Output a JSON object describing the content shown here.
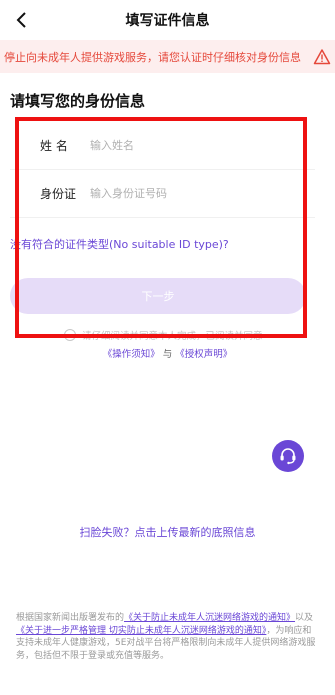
{
  "header": {
    "title": "填写证件信息",
    "back_icon": "chevron-left-icon"
  },
  "notice": {
    "text": "停止向未成年人提供游戏服务，请您认证时仔细核对身份信息",
    "color": "#e5483b",
    "background": "#fdeeee",
    "icon": "warning-icon"
  },
  "section_title": "请填写您的身份信息",
  "form": {
    "name_label": "姓 名",
    "name_placeholder": "输入姓名",
    "id_label": "身份证",
    "id_placeholder": "输入身份证号码"
  },
  "no_id_link": "没有符合的证件类型(No suitable ID type)?",
  "next_button": "下一步",
  "agreement": {
    "text": "请仔细阅读并同意本人完成，已阅读并同意",
    "link1": "《操作须知》",
    "and": " 与 ",
    "link2": "《授权声明》"
  },
  "face_fail": "扫脸失败？点击上传最新的底照信息",
  "footer": {
    "p1": "根据国家新闻出版署发布的",
    "doc1": "《关于防止未成年人沉迷网络游戏的通知》",
    "p2": "以及",
    "doc2": "《关于进一步严格管理 切实防止未成年人沉迷网络游戏的通知》",
    "p3": "，为响应和支持未成年人健康游戏，5E对战平台将严格限制向未成年人提供网络游戏服务，包括但不限于登录或充值等服务。"
  },
  "colors": {
    "accent": "#6a47d6",
    "button_disabled": "#e6dcf8",
    "highlight_frame": "#ee1111"
  },
  "float_icon": "customer-service-icon"
}
